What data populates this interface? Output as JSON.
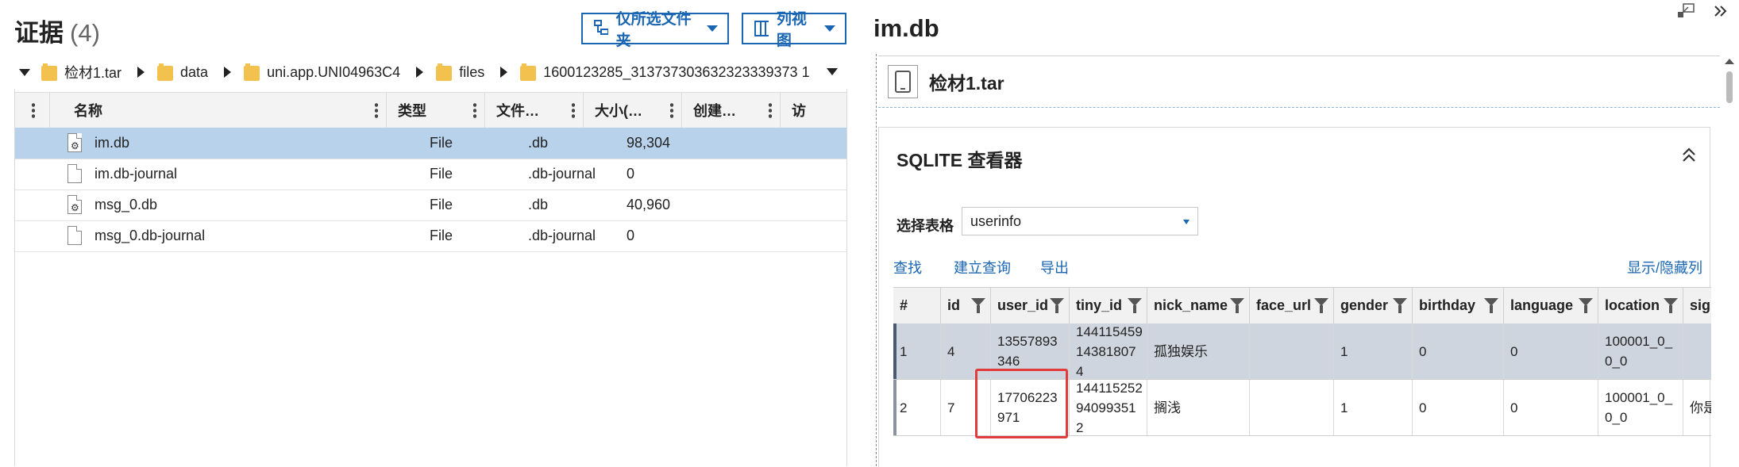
{
  "evidence": {
    "title": "证据",
    "count": "(4)",
    "filter_button": "仅所选文件夹",
    "view_button": "列视图"
  },
  "breadcrumb": [
    "检材1.tar",
    "data",
    "uni.app.UNI04963C4",
    "files",
    "1600123285_313737303632323339373 1"
  ],
  "file_grid": {
    "columns": [
      "名称",
      "类型",
      "文件…",
      "大小(…",
      "创建…",
      "访"
    ],
    "rows": [
      {
        "name": "im.db",
        "type": "File",
        "ext": ".db",
        "size": "98,304",
        "icon": "db-file-icon"
      },
      {
        "name": "im.db-journal",
        "type": "File",
        "ext": ".db-journal",
        "size": "0",
        "icon": "blank-file-icon"
      },
      {
        "name": "msg_0.db",
        "type": "File",
        "ext": ".db",
        "size": "40,960",
        "icon": "db-file-icon"
      },
      {
        "name": "msg_0.db-journal",
        "type": "File",
        "ext": ".db-journal",
        "size": "0",
        "icon": "blank-file-icon"
      }
    ]
  },
  "detail": {
    "title": "im.db",
    "source_label": "检材1.tar",
    "sqlite_title": "SQLITE 查看器",
    "select_label": "选择表格",
    "select_value": "userinfo",
    "links": {
      "find": "查找",
      "build_query": "建立查询",
      "export": "导出",
      "show_hide_cols": "显示/隐藏列"
    }
  },
  "sqlite_grid": {
    "columns": [
      "#",
      "id",
      "user_id",
      "tiny_id",
      "nick_name",
      "face_url",
      "gender",
      "birthday",
      "language",
      "location",
      "sign"
    ],
    "rows": [
      {
        "num": "1",
        "id": "4",
        "user_id": "13557893346",
        "tiny_id": "14411545914381807 4",
        "nick_name": "孤独娱乐",
        "face_url": "",
        "gender": "1",
        "birthday": "0",
        "language": "0",
        "location": "100001_0_0_0",
        "sign": ""
      },
      {
        "num": "2",
        "id": "7",
        "user_id": "17706223971",
        "tiny_id": "14411525294099351 2",
        "nick_name": "搁浅",
        "face_url": "",
        "gender": "1",
        "birthday": "0",
        "language": "0",
        "location": "100001_0_0_0",
        "sign": "你是"
      }
    ]
  },
  "colors": {
    "accent": "#1a66b3",
    "selected_row": "#b7d2ea",
    "highlight": "#e23b3b"
  }
}
